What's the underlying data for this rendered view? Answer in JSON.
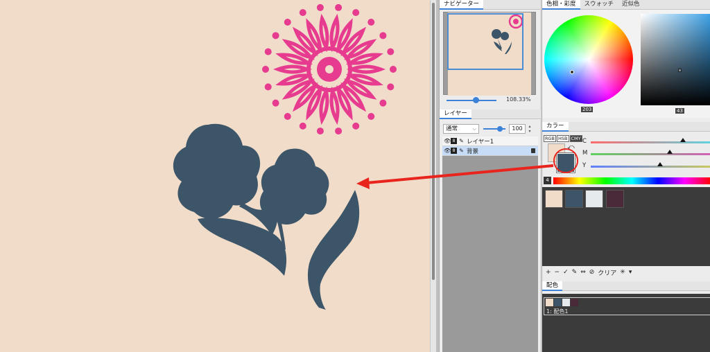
{
  "navigator": {
    "tab_label": "ナビゲーター",
    "zoom_value": "108.33%"
  },
  "layers": {
    "tab_label": "レイヤー",
    "blend_mode": "通常",
    "opacity": "100",
    "items": [
      {
        "name": "レイヤー1",
        "badge": "8",
        "selected": false
      },
      {
        "name": "背景",
        "badge": "8",
        "selected": true,
        "locked": true
      }
    ]
  },
  "color_panel": {
    "tabs": [
      "色相・彩度",
      "スウォッチ",
      "近似色"
    ],
    "active_tab": 0,
    "hue_value": "203",
    "brightness_value": "43",
    "picker_hue_color": "#3da2e8"
  },
  "color_sub": {
    "tab_label": "カラー",
    "modes": [
      "RGB",
      "HSB",
      "CMY"
    ],
    "active_mode": "CMY",
    "sliders": [
      {
        "label": "C",
        "value": 0.77
      },
      {
        "label": "M",
        "value": 0.66
      },
      {
        "label": "Y",
        "value": 0.58
      }
    ],
    "tool_number": "4",
    "foreground_color": "#f0dcc9",
    "background_color": "#3d5568"
  },
  "palette": {
    "swatches": [
      "#f0dcc9",
      "#3d5568",
      "#e6eaec",
      "#4a2a38"
    ],
    "tools": [
      "+",
      "−",
      "✓",
      "✎",
      "⇔",
      "⊘",
      "クリア",
      "✳",
      "▾"
    ]
  },
  "scheme": {
    "tab_label": "配色",
    "swatches": [
      "#f0dcc9",
      "#3d5568",
      "#e6eaec",
      "#4a2a38"
    ],
    "item_label": "1: 配色1"
  },
  "canvas": {
    "background_color": "#f0dcc9",
    "flower_color": "#e63b8f",
    "leaf_color": "#3d5568",
    "arrow_color": "#e8241c"
  }
}
